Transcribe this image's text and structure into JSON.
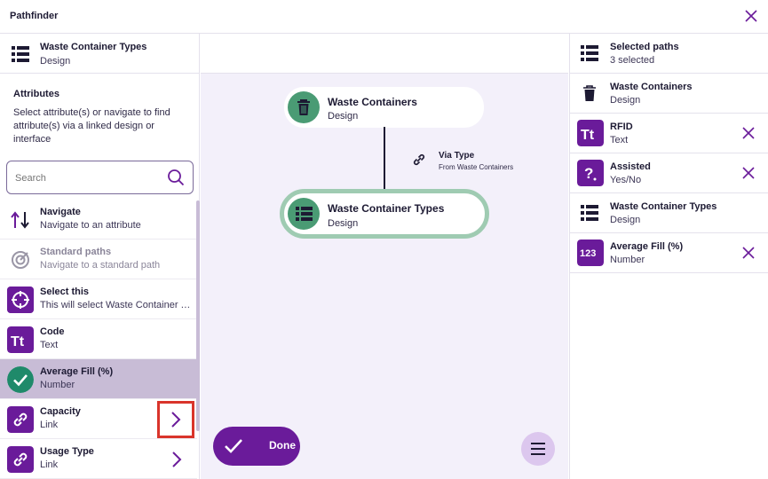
{
  "app": {
    "title": "Pathfinder",
    "close_icon": "close-icon"
  },
  "colors": {
    "accent": "#6a1b9a",
    "node_green": "#4a9b74",
    "selected_row": "#c8bcd6",
    "canvas_bg": "#f3f0fa",
    "highlight_box": "#d9342b"
  },
  "left": {
    "header": {
      "title": "Waste Container Types",
      "subtitle": "Design",
      "icon": "list-icon"
    },
    "attributes_heading": "Attributes",
    "attributes_description": "Select attribute(s) or navigate to find attribute(s) via a linked design or interface",
    "search": {
      "placeholder": "Search",
      "value": ""
    },
    "items": [
      {
        "label": "Navigate",
        "sub": "Navigate to an attribute",
        "icon": "navigate-arrows-icon"
      },
      {
        "label": "Standard paths",
        "sub": "Navigate to a standard path",
        "icon": "target-icon"
      },
      {
        "label": "Select this",
        "sub": "This will select Waste Container Types",
        "icon": "crosshair-icon"
      },
      {
        "label": "Code",
        "sub": "Text",
        "icon": "text-type-icon"
      },
      {
        "label": "Average Fill (%)",
        "sub": "Number",
        "icon": "check-circle-icon"
      },
      {
        "label": "Capacity",
        "sub": "Link",
        "icon": "link-icon"
      },
      {
        "label": "Usage Type",
        "sub": "Link",
        "icon": "link-icon"
      }
    ]
  },
  "canvas": {
    "node_top": {
      "title": "Waste Containers",
      "subtitle": "Design",
      "icon": "trash-icon"
    },
    "connection": {
      "title": "Via Type",
      "subtitle": "From Waste Containers",
      "icon": "link-icon"
    },
    "node_bottom": {
      "title": "Waste Container Types",
      "subtitle": "Design",
      "icon": "list-icon"
    },
    "done_label": "Done"
  },
  "right": {
    "header": {
      "title": "Selected paths",
      "subtitle": "3 selected",
      "icon": "list-icon"
    },
    "paths": [
      {
        "label": "Waste Containers",
        "sub": "Design",
        "icon": "trash-icon",
        "removable": false
      },
      {
        "label": "RFID",
        "sub": "Text",
        "icon": "text-type-icon",
        "removable": true
      },
      {
        "label": "Assisted",
        "sub": "Yes/No",
        "icon": "question-icon",
        "removable": true
      },
      {
        "label": "Waste Container Types",
        "sub": "Design",
        "icon": "list-icon",
        "removable": false
      },
      {
        "label": "Average Fill (%)",
        "sub": "Number",
        "icon": "number-icon",
        "removable": true
      }
    ]
  }
}
